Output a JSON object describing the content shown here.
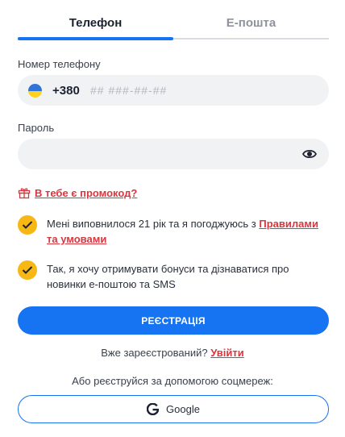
{
  "tabs": {
    "phone": "Телефон",
    "email": "Е-пошта"
  },
  "phone_field": {
    "label": "Номер телефону",
    "country_code": "+380",
    "placeholder": "## ###-##-##",
    "flag_colors": [
      "#2f74d6",
      "#ffd21f"
    ]
  },
  "password_field": {
    "label": "Пароль",
    "value": "",
    "toggle_icon": "eye-icon"
  },
  "promo": {
    "text": "В тебе є промокод?",
    "icon": "gift-icon"
  },
  "agreements": [
    {
      "checked": true,
      "text": "Мені виповнилося 21 рік та я погоджуюсь з ",
      "link": "Правилами та умовами"
    },
    {
      "checked": true,
      "text": "Так, я хочу отримувати бонуси та дізнаватися про новинки е-поштою та SMS"
    }
  ],
  "register_button": "РЕЄСТРАЦІЯ",
  "login": {
    "text": "Вже зареєстрований? ",
    "link": "Увійти"
  },
  "social": {
    "text": "Або реєструйся за допомогою соцмереж:",
    "google_label": "Google"
  },
  "colors": {
    "accent": "#1673f2",
    "link": "#d7373f",
    "checkbox": "#f7b815"
  }
}
